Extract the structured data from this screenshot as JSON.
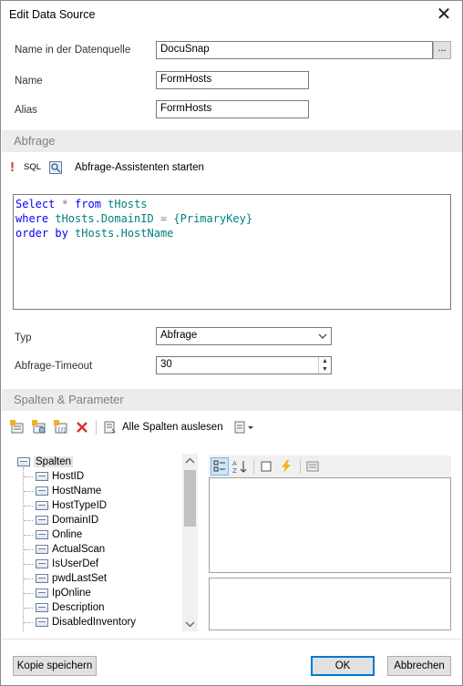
{
  "window": {
    "title": "Edit Data Source",
    "close_glyph": "✕"
  },
  "fields": {
    "datasource_label": "Name in der Datenquelle",
    "datasource_value": "DocuSnap",
    "datasource_button": "...",
    "name_label": "Name",
    "name_value": "FormHosts",
    "alias_label": "Alias",
    "alias_value": "FormHosts"
  },
  "query_section": {
    "header": "Abfrage",
    "sql_label": "SQL",
    "wizard_label": "Abfrage-Assistenten starten",
    "sql_lines": [
      [
        {
          "t": "Select",
          "c": "kw"
        },
        {
          "t": " * ",
          "c": "op"
        },
        {
          "t": "from",
          "c": "kw"
        },
        {
          "t": " tHosts",
          "c": "id"
        }
      ],
      [
        {
          "t": "where",
          "c": "kw"
        },
        {
          "t": " tHosts.DomainID ",
          "c": "id"
        },
        {
          "t": "=",
          "c": "op"
        },
        {
          "t": " {PrimaryKey}",
          "c": "id"
        }
      ],
      [
        {
          "t": "order by",
          "c": "kw"
        },
        {
          "t": " tHosts.HostName",
          "c": "id"
        }
      ]
    ],
    "type_label": "Typ",
    "type_value": "Abfrage",
    "timeout_label": "Abfrage-Timeout",
    "timeout_value": "30"
  },
  "columns_section": {
    "header": "Spalten & Parameter",
    "read_all_label": "Alle Spalten auslesen",
    "tree_root": "Spalten",
    "tree_items": [
      "HostID",
      "HostName",
      "HostTypeID",
      "DomainID",
      "Online",
      "ActualScan",
      "IsUserDef",
      "pwdLastSet",
      "IpOnline",
      "Description",
      "DisabledInventory"
    ]
  },
  "footer": {
    "save_copy": "Kopie speichern",
    "ok": "OK",
    "cancel": "Abbrechen"
  },
  "colors": {
    "section_bg": "#ececec",
    "sql_keyword": "#0000ff",
    "sql_identifier": "#008080",
    "delete_red": "#d9342b",
    "accent_blue": "#0078d7"
  }
}
